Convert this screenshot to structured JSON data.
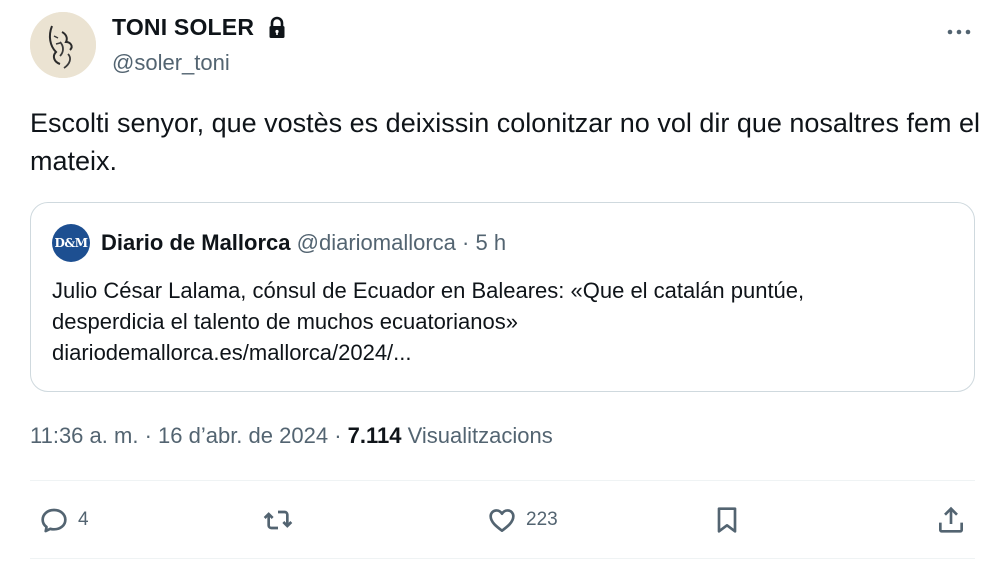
{
  "author": {
    "name": "TONI SOLER",
    "handle": "@soler_toni"
  },
  "tweet": {
    "text": "Escolti senyor, que vostès es deixissin colonitzar no vol dir que nosaltres fem el mateix."
  },
  "quote": {
    "avatar_text": "D&M",
    "name": "Diario de Mallorca",
    "handle": "@diariomallorca",
    "separator": "·",
    "time": "5 h",
    "text_line1": "Julio César Lalama, cónsul de Ecuador en Baleares: «Que el catalán puntúe,",
    "text_line2": "desperdicia el talento de muchos ecuatorianos»",
    "link": "diariodemallorca.es/mallorca/2024/..."
  },
  "meta": {
    "time": "11:36 a. m.",
    "separator1": "·",
    "date": "16 d’abr. de 2024",
    "separator2": "·",
    "views_count": "7.114",
    "views_label": "Visualitzacions"
  },
  "actions": {
    "replies": "4",
    "likes": "223"
  },
  "icons": [
    "lock-icon",
    "more-icon",
    "reply-icon",
    "retweet-icon",
    "like-icon",
    "bookmark-icon",
    "share-icon"
  ],
  "colors": {
    "text": "#0f1419",
    "secondary": "#536471",
    "border": "#cfd9de"
  }
}
